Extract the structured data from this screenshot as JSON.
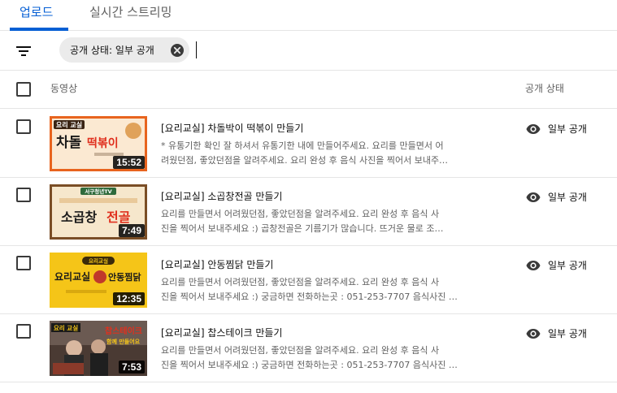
{
  "tabs": [
    {
      "label": "업로드",
      "active": true
    },
    {
      "label": "실시간 스트리밍",
      "active": false
    }
  ],
  "filter": {
    "chip_label": "공개 상태: 일부 공개",
    "filter_icon": "filter-lines-icon",
    "clear_icon": "close-circle-icon"
  },
  "table": {
    "columns": {
      "video": "동영상",
      "visibility": "공개 상태"
    }
  },
  "colors": {
    "accent": "#065fd4",
    "text_secondary": "#606060",
    "chip_bg": "#ebebeb"
  },
  "videos": [
    {
      "title": "[요리교실] 차돌박이 떡볶이 만들기",
      "description_line1": "* 유통기한 확인 잘 하셔서 유통기한 내에 만들어주세요. 요리를 만들면서 어",
      "description_line2": "려웠던점, 좋았던점을 알려주세요. 요리 완성 후 음식 사진을 찍어서 보내주…",
      "duration": "15:52",
      "visibility": "일부 공개",
      "thumb_badge": "요리 교실",
      "thumb_text_a": "차돌",
      "thumb_text_b": "떡볶이"
    },
    {
      "title": "[요리교실] 소곱창전골 만들기",
      "description_line1": "요리를 만들면서 어려웠던점, 좋았던점을 알려주세요. 요리 완성 후 음식 사",
      "description_line2": "진을 찍어서 보내주세요 :) 곱창전골은 기름기가 많습니다. 뜨거운 물로 조…",
      "duration": "7:49",
      "visibility": "일부 공개",
      "thumb_badge": "서구청년TV",
      "thumb_text_a": "소곱창",
      "thumb_text_b": "전골"
    },
    {
      "title": "[요리교실] 안동찜닭 만들기",
      "description_line1": "요리를 만들면서 어려웠던점, 좋았던점을 알려주세요. 요리 완성 후 음식 사",
      "description_line2": "진을 찍어서 보내주세요 :) 궁금하면 전화하는곳 : 051-253-7707 음식사진 …",
      "duration": "12:35",
      "visibility": "일부 공개",
      "thumb_badge": "요리교실",
      "thumb_text_a": "요리교실",
      "thumb_text_b": "안동찜닭"
    },
    {
      "title": "[요리교실] 찹스테이크 만들기",
      "description_line1": "요리를 만들면서 어려웠던점, 좋았던점을 알려주세요. 요리 완성 후 음식 사",
      "description_line2": "진을 찍어서 보내주세요 :) 궁금하면 전화하는곳 : 051-253-7707 음식사진 …",
      "duration": "7:53",
      "visibility": "일부 공개",
      "thumb_badge": "요리 교실",
      "thumb_text_a": "찹스테이크",
      "thumb_text_b": "함께 만들어요"
    }
  ]
}
